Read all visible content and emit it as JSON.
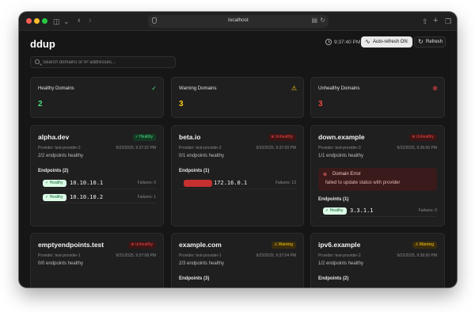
{
  "browser": {
    "url": "localhost"
  },
  "app": {
    "title": "ddup",
    "time": "9:37:40 PM",
    "auto_refresh_label": "Auto-refresh ON",
    "refresh_label": "Refresh",
    "search_placeholder": "Search domains or IP addresses..."
  },
  "summary": [
    {
      "title": "Healthy Domains",
      "count": "2",
      "color": "#4ade80"
    },
    {
      "title": "Warning Domains",
      "count": "3",
      "color": "#facc15"
    },
    {
      "title": "Unhealthy Domains",
      "count": "3",
      "color": "#ef4444"
    }
  ],
  "domains": [
    {
      "name": "alpha.dev",
      "status": "Healthy",
      "provider": "Provider: test-provider-2",
      "updated": "9/22/2025, 9:37:02 PM",
      "summary": "2/2 endpoints healthy",
      "endpoints_label": "Endpoints (2)",
      "endpoints": [
        {
          "status": "Healthy",
          "ip": "10.10.10.1",
          "failures": "Failures: 0"
        },
        {
          "status": "Healthy",
          "ip": "10.10.10.2",
          "failures": "Failures: 1"
        }
      ]
    },
    {
      "name": "beta.io",
      "status": "Unhealthy",
      "provider": "Provider: test-provider-2",
      "updated": "9/22/2025, 9:37:00 PM",
      "summary": "0/1 endpoints healthy",
      "endpoints_label": "Endpoints (1)",
      "endpoints": [
        {
          "status": "",
          "ip": "172.16.0.1",
          "failures": "Failures: 13"
        }
      ]
    },
    {
      "name": "down.example",
      "status": "Unhealthy",
      "provider": "Provider: test-provider-3",
      "updated": "9/22/2025, 9:36:00 PM",
      "summary": "1/1 endpoints healthy",
      "error_title": "Domain Error",
      "error_message": "failed to update status with provider",
      "endpoints_label": "Endpoints (1)",
      "endpoints": [
        {
          "status": "Healthy",
          "ip": "3.3.1.1",
          "failures": "Failures: 0"
        }
      ]
    },
    {
      "name": "emptyendpoints.test",
      "status": "Unhealthy",
      "provider": "Provider: test-provider-1",
      "updated": "9/21/2025, 9:37:08 PM",
      "summary": "0/0 endpoints healthy"
    },
    {
      "name": "example.com",
      "status": "Warning",
      "provider": "Provider: test-provider-1",
      "updated": "9/22/2025, 9:37:04 PM",
      "summary": "2/3 endpoints healthy",
      "endpoints_label": "Endpoints (3)"
    },
    {
      "name": "ipv6.example",
      "status": "Warning",
      "provider": "Provider: test-provider-2",
      "updated": "9/22/2025, 9:36:50 PM",
      "summary": "1/2 endpoints healthy",
      "endpoints_label": "Endpoints (2)"
    }
  ]
}
